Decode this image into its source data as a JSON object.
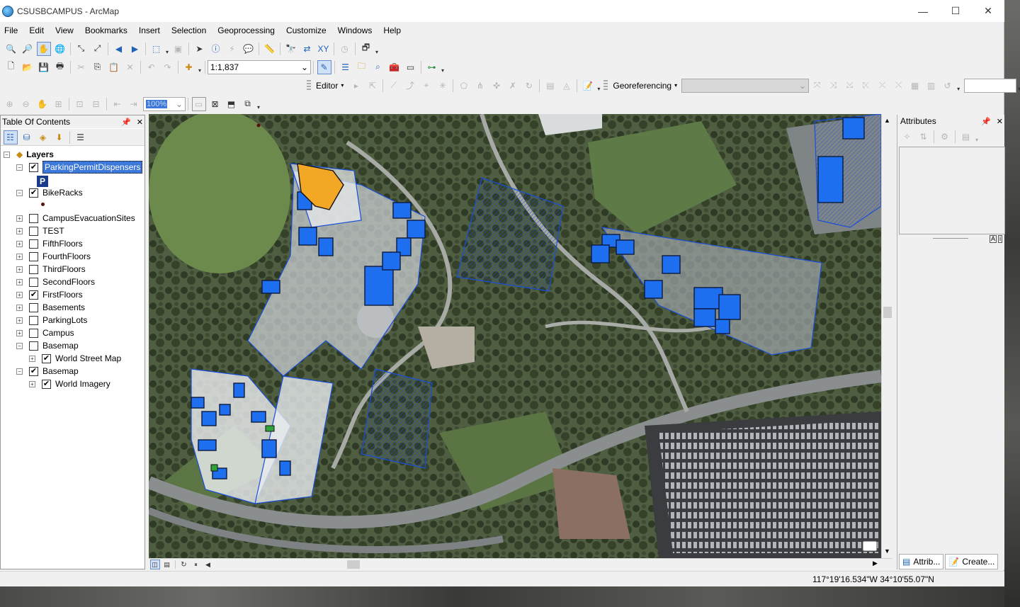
{
  "window": {
    "title": "CSUSBCAMPUS - ArcMap"
  },
  "menu": [
    "File",
    "Edit",
    "View",
    "Bookmarks",
    "Insert",
    "Selection",
    "Geoprocessing",
    "Customize",
    "Windows",
    "Help"
  ],
  "toolbar": {
    "scale": "1:1,837",
    "editor_label": "Editor",
    "georef_label": "Georeferencing",
    "zoom_percent": "100%"
  },
  "toc": {
    "title": "Table Of Contents",
    "root": "Layers",
    "layers": [
      {
        "label": "ParkingPermitDispensers",
        "checked": true,
        "selected": true,
        "expanded": true
      },
      {
        "label": "BikeRacks",
        "checked": true,
        "expanded": true
      },
      {
        "label": "CampusEvacuationSites",
        "checked": false
      },
      {
        "label": "TEST",
        "checked": false
      },
      {
        "label": "FifthFloors",
        "checked": false
      },
      {
        "label": "FourthFloors",
        "checked": false
      },
      {
        "label": "ThirdFloors",
        "checked": false
      },
      {
        "label": "SecondFloors",
        "checked": false
      },
      {
        "label": "FirstFloors",
        "checked": true
      },
      {
        "label": "Basements",
        "checked": false
      },
      {
        "label": "ParkingLots",
        "checked": false
      },
      {
        "label": "Campus",
        "checked": false
      },
      {
        "label": "Basemap",
        "checked": false,
        "expanded": true
      },
      {
        "label": "World Street Map",
        "checked": true,
        "sub": true
      },
      {
        "label": "Basemap",
        "checked": true,
        "expanded": true
      },
      {
        "label": "World Imagery",
        "checked": true,
        "sub": true
      }
    ],
    "legend_symbol": "P"
  },
  "attributes": {
    "title": "Attributes",
    "tabs": [
      "Attrib...",
      "Create..."
    ]
  },
  "status": {
    "coordinates": "117°19'16.534\"W  34°10'55.07\"N"
  },
  "colors": {
    "selection": "#3c78d8",
    "feature_fill": "#1e6ef0",
    "feature_outline": "#1a4fd6",
    "parking_fill": "#f2a825"
  }
}
